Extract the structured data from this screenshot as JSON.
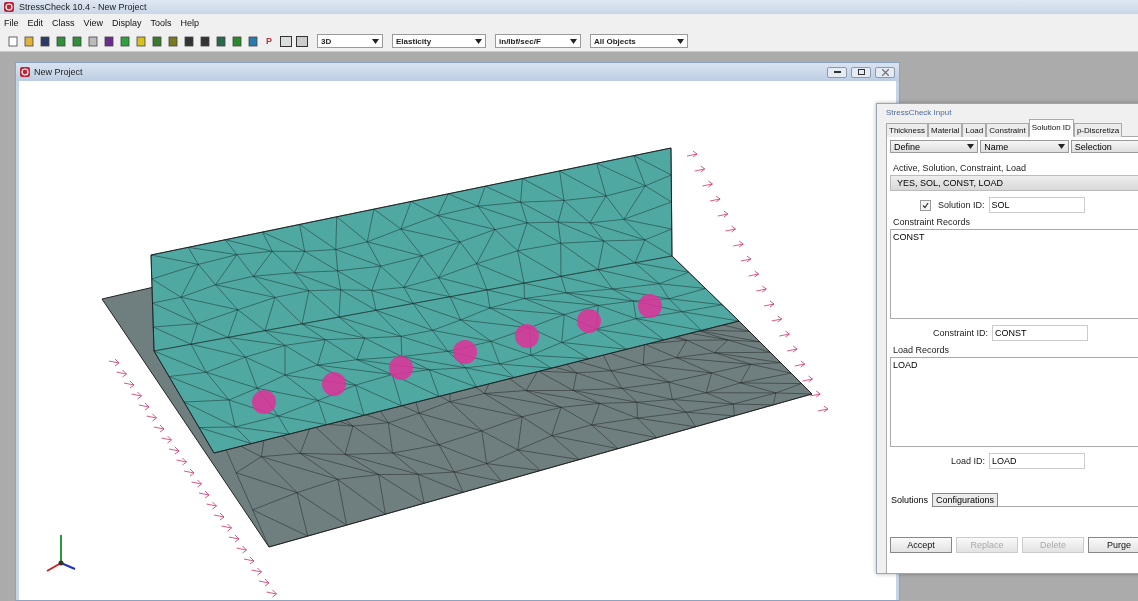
{
  "app_title": "StressCheck 10.4 - New Project",
  "menu": [
    "File",
    "Edit",
    "Class",
    "View",
    "Display",
    "Tools",
    "Help"
  ],
  "toolbar": {
    "p_label": "P",
    "dropdowns": [
      "3D",
      "Elasticity",
      "in/lbf/sec/F",
      "All Objects"
    ]
  },
  "document_window": {
    "title": "New Project"
  },
  "dialog": {
    "title": "StressCheck Input",
    "tabs": [
      {
        "label": "Thickness",
        "selected": false
      },
      {
        "label": "Material",
        "selected": false
      },
      {
        "label": "Load",
        "selected": false
      },
      {
        "label": "Constraint",
        "selected": false
      },
      {
        "label": "Solution ID",
        "selected": true
      },
      {
        "label": "p-Discretiza",
        "selected": false
      }
    ],
    "dropdowns": [
      "Define",
      "Name",
      "Selection"
    ],
    "active_label": "Active, Solution, Constraint, Load",
    "active_rows": [
      {
        "text": "YES,  SOL, CONST, LOAD",
        "selected": true
      }
    ],
    "solution_checkbox": {
      "checked": true
    },
    "solution_id": {
      "label": "Solution ID:",
      "value": "SOL"
    },
    "constraint_records": {
      "label": "Constraint Records",
      "items": [
        "CONST"
      ]
    },
    "constraint_id": {
      "label": "Constraint ID:",
      "value": "CONST"
    },
    "load_records": {
      "label": "Load Records",
      "items": [
        "LOAD"
      ]
    },
    "load_id": {
      "label": "Load ID:",
      "value": "LOAD"
    },
    "bottom_tabs": [
      {
        "label": "Solutions",
        "selected": true
      },
      {
        "label": "Configurations",
        "selected": false
      }
    ],
    "buttons": [
      {
        "label": "Accept",
        "disabled": false
      },
      {
        "label": "Replace",
        "disabled": true
      },
      {
        "label": "Delete",
        "disabled": true
      },
      {
        "label": "Purge",
        "disabled": false
      }
    ]
  }
}
